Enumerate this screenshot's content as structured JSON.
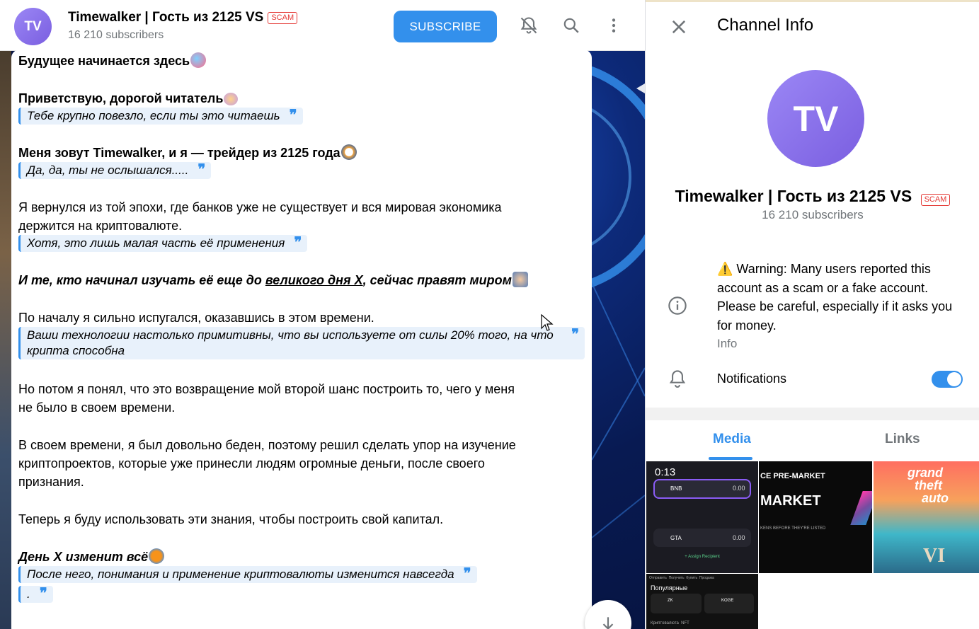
{
  "channel": {
    "avatar_initials": "TV",
    "title": "Timewalker | Гость из 2125 VS",
    "scam_badge": "SCAM",
    "subscribers": "16 210 subscribers",
    "subscribe_label": "SUBSCRIBE",
    "header_icons": [
      "mute-bell-icon",
      "search-icon",
      "more-vertical-icon"
    ]
  },
  "message": {
    "l1": "Будущее начинается здесь",
    "l2": "Приветствую, дорогой читатель",
    "q1": "Тебе крупно повезло, если ты это читаешь",
    "l3": "Меня зовут Timewalker, и я — трейдер из 2125 года",
    "q2": "Да, да, ты не ослышался.....",
    "l4a": "Я вернулся из той эпохи, где банков уже не существует и вся мировая экономика",
    "l4b": "держится на криптовалюте.",
    "q3": "Хотя, это лишь малая часть её применения",
    "l5a": "И те, кто начинал изучать её еще до ",
    "l5u": "великого дня Х",
    "l5b": ", сейчас правят миром",
    "l6": "По началу я сильно испугался, оказавшись в этом времени.",
    "q4": "Ваши технологии настолько примитивны, что вы используете от силы 20% того, на что крипта способна",
    "l7a": "Но потом я понял, что это возвращение мой второй шанс построить то, чего у меня",
    "l7b": "не было в своем времени.",
    "l8a": "В своем времени, я был довольно беден, поэтому решил сделать упор на изучение",
    "l8b": "криптопроектов, которые уже принесли людям огромные деньги, после своего",
    "l8c": "признания.",
    "l9": "Теперь я буду использовать эти знания, чтобы построить свой капитал.",
    "l10": "День Х изменит всё",
    "q5": "После него, понимания и применение криптовалюты изменится навсегда",
    "q6": ".",
    "quote_mark": "❞"
  },
  "info_panel": {
    "title": "Channel Info",
    "avatar_initials": "TV",
    "name": "Timewalker | Гость из 2125 VS",
    "scam_badge": "SCAM",
    "subscribers": "16 210 subscribers",
    "warning": "⚠️ Warning: Many users reported this account as a scam or a fake account. Please be careful, especially if it asks you for money.",
    "info_label": "Info",
    "notifications_label": "Notifications",
    "notifications_on": true,
    "tabs": [
      "Media",
      "Links"
    ],
    "active_tab": "Media"
  },
  "media": {
    "t1_duration": "0:13",
    "t1_token1": "BNB",
    "t1_value1": "0.00",
    "t1_token2": "GTA",
    "t1_value2": "0.00",
    "t1_assign": "+ Assign Recipient",
    "t2_line1": "CE PRE-MARKET",
    "t2_line2": "MARKET",
    "t2_line3": "KENS BEFORE THEY'RE LISTED",
    "t3_line1": "grand",
    "t3_line2": "theft",
    "t3_line3": "auto",
    "t3_line4": "VI",
    "t4_menu": "Отправить  Получить  Купить  Продажа",
    "t4_popular": "Популярные",
    "t4_token1": "ZK",
    "t4_token2": "KOGE",
    "t4_tabs": "Криптовалюта  NFT"
  },
  "colors": {
    "accent": "#3390ec",
    "scam": "#e53935",
    "avatar": "#8b6ff0"
  }
}
